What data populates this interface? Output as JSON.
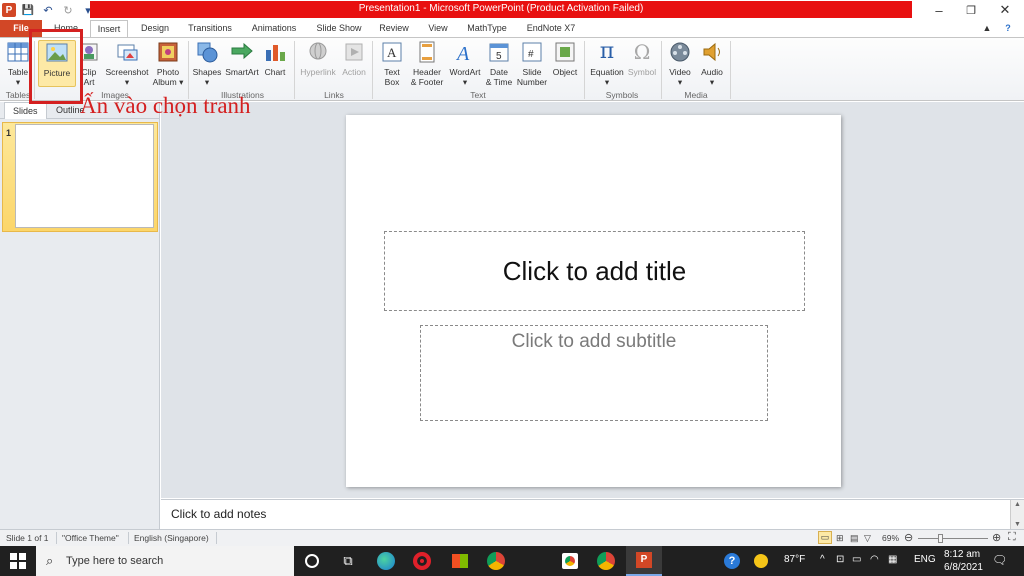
{
  "window": {
    "title": "Presentation1 - Microsoft PowerPoint (Product Activation Failed)",
    "minimize": "–",
    "restore": "❐",
    "close": "✕"
  },
  "qat": {
    "app": "P",
    "save": "💾",
    "undo": "↶",
    "redo": "↻",
    "more": "▾"
  },
  "tabs": [
    "File",
    "Home",
    "Insert",
    "Design",
    "Transitions",
    "Animations",
    "Slide Show",
    "Review",
    "View",
    "MathType",
    "EndNote X7"
  ],
  "ribbon": {
    "buttons": {
      "table": "Table",
      "picture": "Picture",
      "clip_art_1": "Clip",
      "clip_art_2": "Art",
      "screenshot": "Screenshot",
      "photo_album_1": "Photo",
      "photo_album_2": "Album ▾",
      "shapes": "Shapes",
      "smartart": "SmartArt",
      "chart": "Chart",
      "hyperlink": "Hyperlink",
      "action": "Action",
      "textbox_1": "Text",
      "textbox_2": "Box",
      "header_1": "Header",
      "header_2": "& Footer",
      "wordart": "WordArt",
      "datetime_1": "Date",
      "datetime_2": "& Time",
      "slidenum_1": "Slide",
      "slidenum_2": "Number",
      "object": "Object",
      "equation": "Equation",
      "symbol": "Symbol",
      "video": "Video",
      "audio": "Audio"
    },
    "groups": {
      "tables": "Tables",
      "images": "Images",
      "illustrations": "Illustrations",
      "links": "Links",
      "text": "Text",
      "symbols": "Symbols",
      "media": "Media"
    }
  },
  "annotation": "Ấn vào chọn tranh",
  "left_pane": {
    "tab_slides": "Slides",
    "tab_outline": "Outline",
    "slide_number": "1"
  },
  "slide": {
    "title_placeholder": "Click to add title",
    "subtitle_placeholder": "Click to add subtitle"
  },
  "notes": {
    "placeholder": "Click to add notes"
  },
  "status": {
    "slide": "Slide 1 of 1",
    "theme": "\"Office Theme\"",
    "language": "English (Singapore)",
    "zoom": "69%"
  },
  "taskbar": {
    "search_placeholder": "Type here to search",
    "temperature": "87°F",
    "lang": "ENG",
    "time": "8:12 am",
    "date": "6/8/2021"
  },
  "colors": {
    "accent": "#d24726",
    "title_red": "#e81010",
    "annotation_red": "#d42020"
  }
}
